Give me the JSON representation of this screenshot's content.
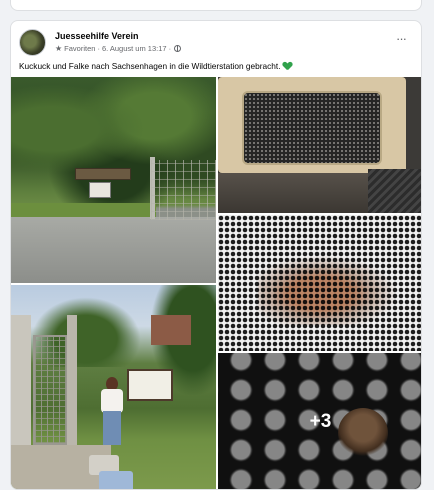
{
  "post": {
    "author": "Juesseehilfe Verein",
    "favorites_label": "Favoriten",
    "separator": "·",
    "date": "6. August um 13:17",
    "more_button": "···",
    "text": "Kuckuck und Falke nach Sachsenhagen in die Wildtierstation  gebracht.",
    "extra_photos_label": "+3"
  },
  "icons": {
    "favorites": "star-icon",
    "audience": "globe-icon",
    "emoji": "green-heart-icon"
  },
  "colors": {
    "page_bg": "#f0f2f5",
    "card_bg": "#ffffff",
    "text": "#050505",
    "secondary_text": "#65676b",
    "heart": "#31a24c"
  }
}
